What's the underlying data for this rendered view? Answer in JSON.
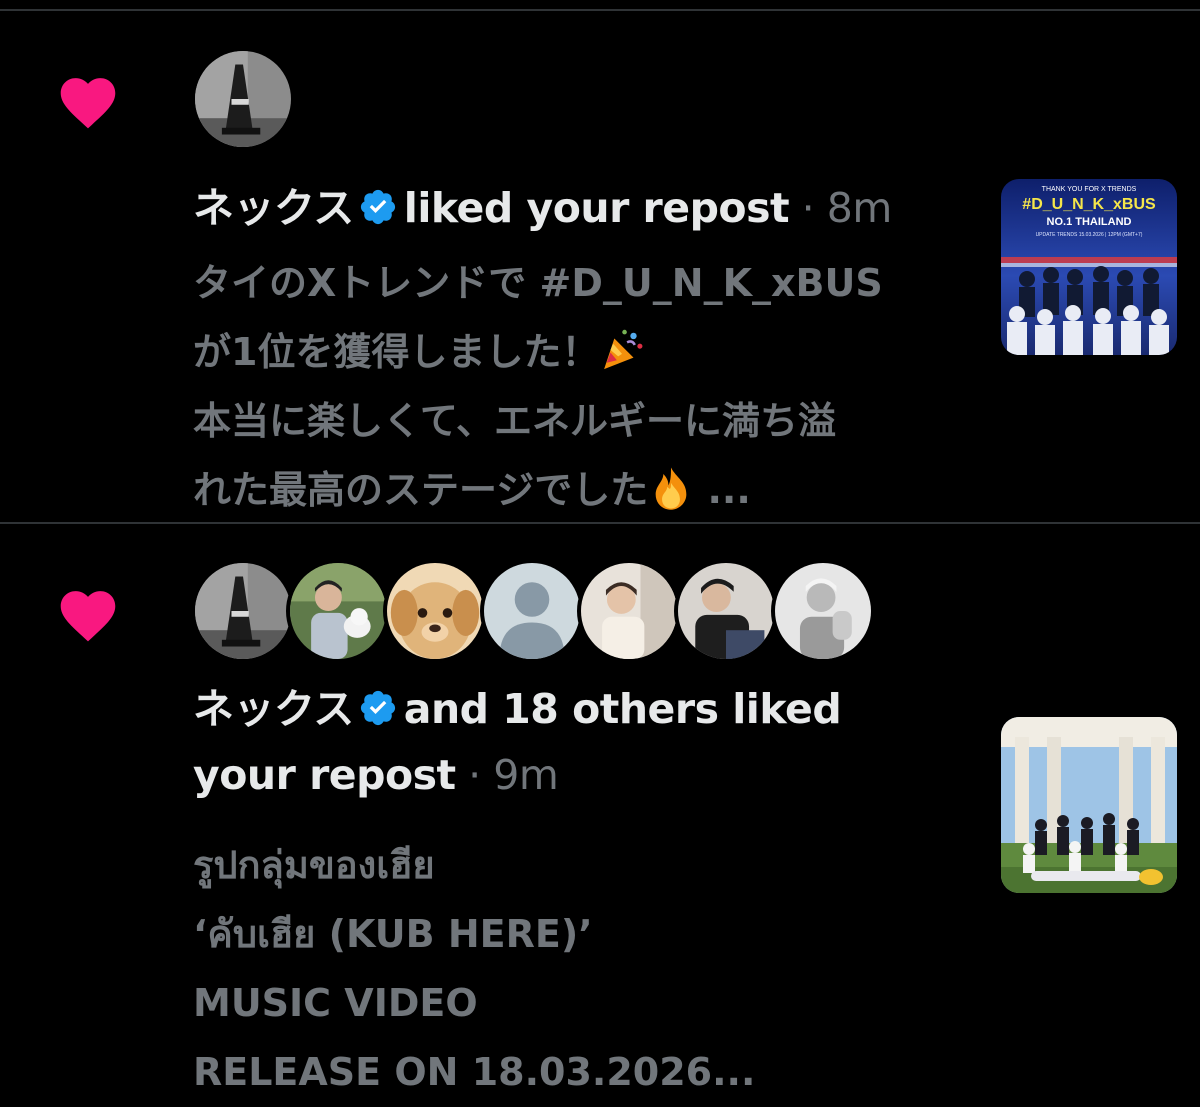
{
  "colors": {
    "background": "#000000",
    "divider": "#2f3336",
    "heart": "#f91880",
    "primary_text": "#e7e9ea",
    "secondary_text": "#71767b",
    "verified": "#1d9bf0"
  },
  "notifications": [
    {
      "icon": "heart-icon",
      "user_name": "ネックス",
      "verified": true,
      "action": "liked your repost",
      "separator": "·",
      "time": "8m",
      "body_lines": [
        {
          "text": "タイのXトレンドで #D_U_N_K_xBUS"
        },
        {
          "text": "が1位を獲得しました！",
          "emoji": "party-popper-icon"
        },
        {
          "text": "本当に楽しくて、エネルギーに満ち溢"
        },
        {
          "text": "れた最高のステージでした",
          "emoji": "fire-icon",
          "suffix": " ..."
        }
      ],
      "thumbnail": {
        "lines": [
          "THANK YOU FOR X TRENDS",
          "#D_U_N_K_xBUS",
          "NO.1 THAILAND",
          "UPDATE TRENDS 15.03.2026 | 12PM (GMT+7)"
        ]
      }
    },
    {
      "icon": "heart-icon",
      "user_name": "ネックス",
      "verified": true,
      "action_line1": "and 18 others liked",
      "action_line2": "your repost",
      "separator": "·",
      "time": "9m",
      "body_lines": [
        {
          "text": "รูปกลุ่มของเฮีย"
        },
        {
          "text": "‘คับเฮีย (KUB HERE)’"
        },
        {
          "text": "MUSIC VIDEO"
        },
        {
          "text": "RELEASE ON 18.03.2026..."
        }
      ]
    }
  ]
}
